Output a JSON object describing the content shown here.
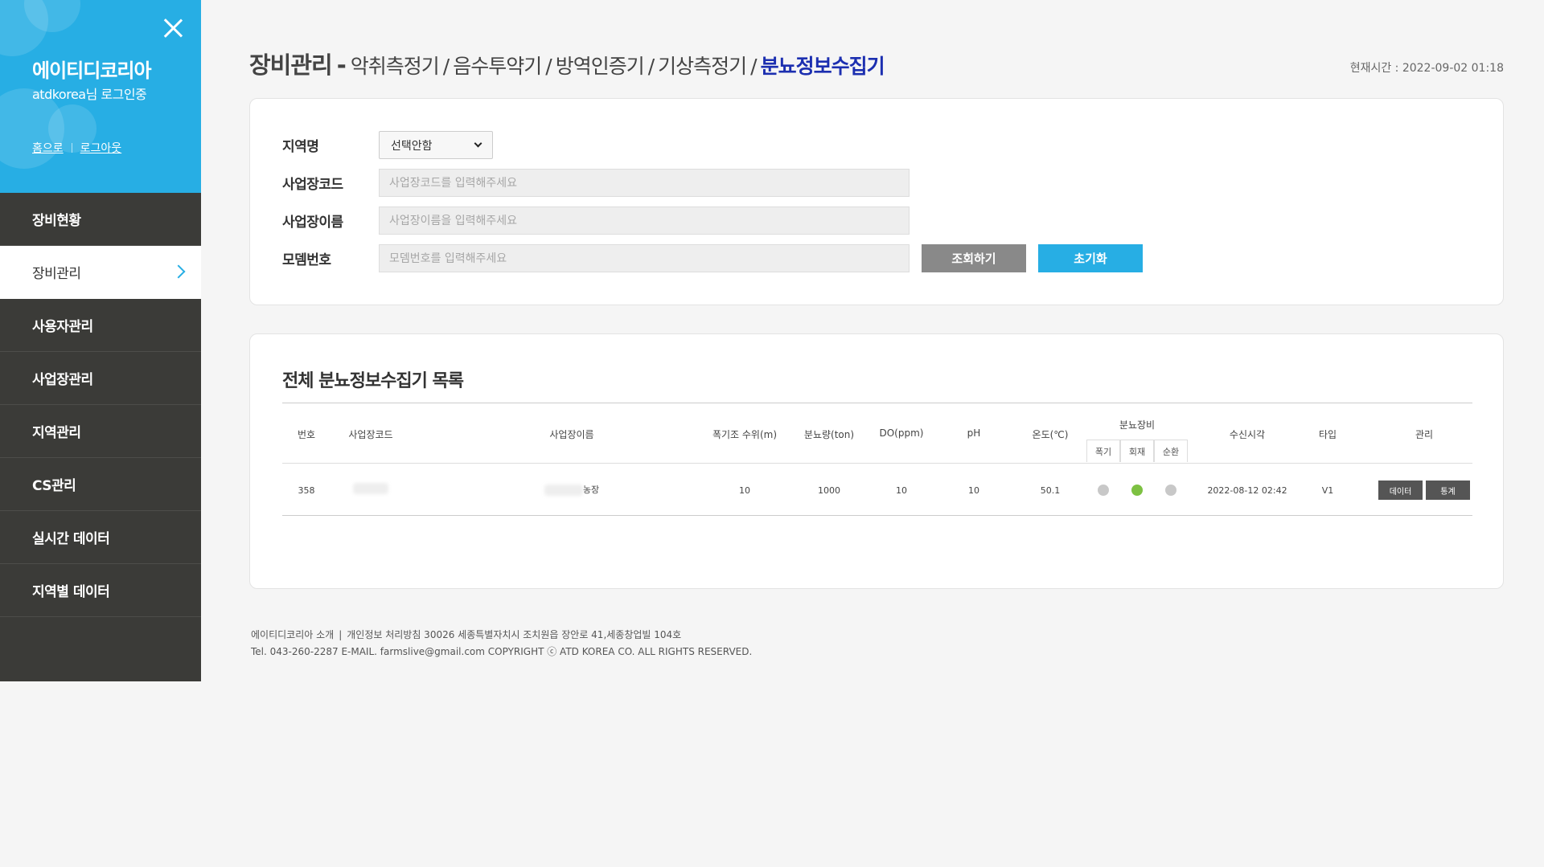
{
  "sidebar": {
    "brand": "에이티디코리아",
    "login_status": "atdkorea님 로그인중",
    "home_link": "홈으로",
    "logout_link": "로그아웃",
    "menu": [
      {
        "label": "장비현황"
      },
      {
        "label": "장비관리",
        "active": true
      },
      {
        "label": "사용자관리"
      },
      {
        "label": "사업장관리"
      },
      {
        "label": "지역관리"
      },
      {
        "label": "CS관리"
      },
      {
        "label": "실시간 데이터"
      },
      {
        "label": "지역별 데이터"
      }
    ]
  },
  "header": {
    "title": "장비관리",
    "dash": "-",
    "crumbs": [
      "악취측정기",
      "음수투약기",
      "방역인증기",
      "기상측정기"
    ],
    "current": "분뇨정보수집기",
    "time_label": "현재시간 : 2022-09-02 01:18"
  },
  "search": {
    "region_label": "지역명",
    "region_value": "선택안함",
    "code_label": "사업장코드",
    "code_placeholder": "사업장코드를 입력해주세요",
    "name_label": "사업장이름",
    "name_placeholder": "사업장이름을 입력해주세요",
    "model_label": "모뎀번호",
    "model_placeholder": "모뎀번호를 입력해주세요",
    "search_button": "조회하기",
    "reset_button": "초기화"
  },
  "list": {
    "title": "전체 분뇨정보수집기 목록",
    "columns": {
      "no": "번호",
      "code": "사업장코드",
      "name": "사업장이름",
      "level": "폭기조 수위(m)",
      "amount": "분뇨량(ton)",
      "do": "DO(ppm)",
      "ph": "pH",
      "temp": "온도(℃)",
      "equip": "분뇨장비",
      "equip_sub": [
        "폭기",
        "회재",
        "순환"
      ],
      "received": "수신시각",
      "type": "타입",
      "manage": "관리"
    },
    "rows": [
      {
        "no": "358",
        "name_suffix": "농장",
        "level": "10",
        "amount": "1000",
        "do": "10",
        "ph": "10",
        "temp": "50.1",
        "equip_status": [
          "#c8c8c8",
          "#7dc142",
          "#c8c8c8"
        ],
        "received": "2022-08-12 02:42",
        "type": "V1",
        "data_button": "데이터",
        "stats_button": "통계"
      }
    ]
  },
  "footer": {
    "about": "에이티디코리아 소개",
    "sep": "|",
    "privacy": "개인정보 처리방침 30026 세종특별자치시 조치원읍 장안로 41,세종창업빌 104호",
    "contact": "Tel. 043-260-2287 E-MAIL. farmslive@gmail.com COPYRIGHT ⓒ ATD KOREA CO. ALL RIGHTS RESERVED."
  },
  "colors": {
    "sidebar_head": "#27aee4",
    "sidebar_menu": "#3b3b38",
    "current_crumb": "#1c2fb0",
    "status_green": "#7dc142",
    "status_gray": "#c8c8c8"
  }
}
